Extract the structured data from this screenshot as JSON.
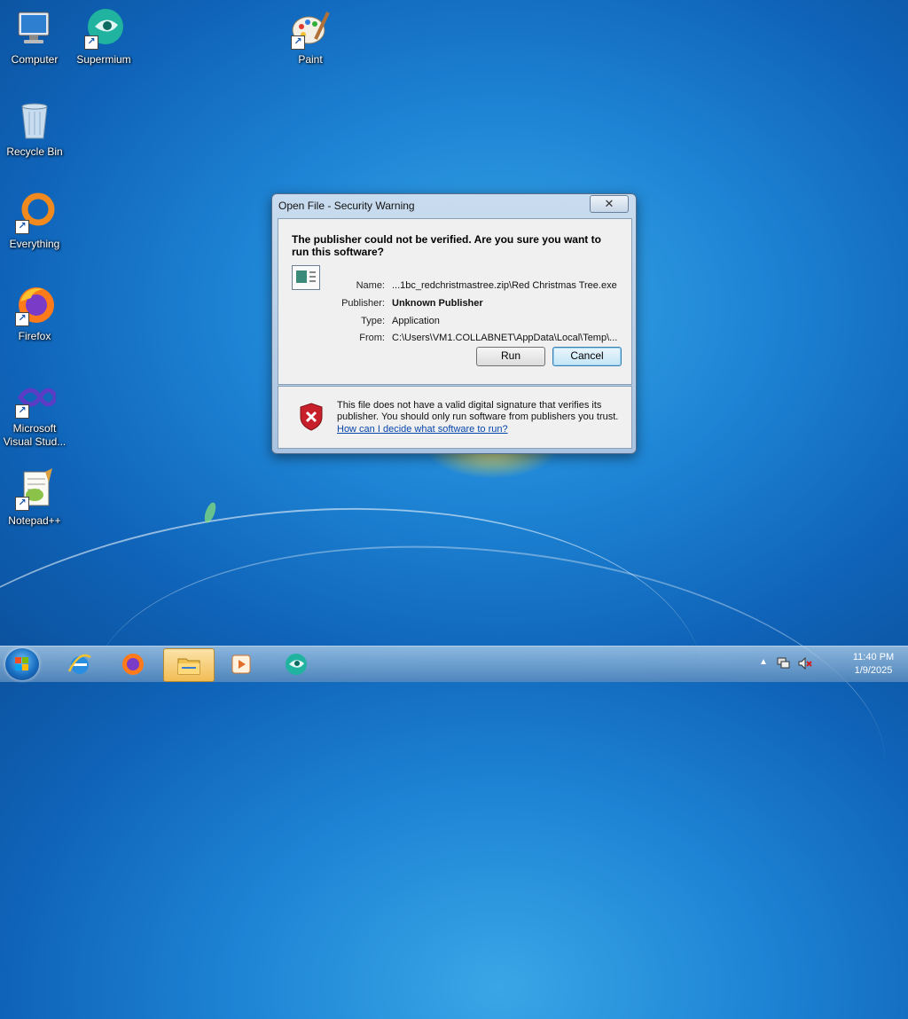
{
  "desktop": {
    "icons": [
      {
        "label": "Computer"
      },
      {
        "label": "Supermium"
      },
      {
        "label": "Paint"
      },
      {
        "label": "Recycle Bin"
      },
      {
        "label": "Everything"
      },
      {
        "label": "Firefox"
      },
      {
        "label": "Microsoft Visual Stud..."
      },
      {
        "label": "Notepad++"
      }
    ]
  },
  "dialog": {
    "title": "Open File - Security Warning",
    "close_glyph": "✕",
    "heading": "The publisher could not be verified.  Are you sure you want to run this software?",
    "fields": {
      "name_label": "Name:",
      "name_value": "...1bc_redchristmastree.zip\\Red Christmas Tree.exe",
      "publisher_label": "Publisher:",
      "publisher_value": "Unknown Publisher",
      "type_label": "Type:",
      "type_value": "Application",
      "from_label": "From:",
      "from_value": "C:\\Users\\VM1.COLLABNET\\AppData\\Local\\Temp\\..."
    },
    "run_label": "Run",
    "cancel_label": "Cancel",
    "warning_text": "This file does not have a valid digital signature that verifies its publisher.  You should only run software from publishers you trust.",
    "help_link": "How can I decide what software to run?"
  },
  "taskbar": {
    "items": [
      {
        "icon": "internet-explorer-icon"
      },
      {
        "icon": "firefox-icon"
      },
      {
        "icon": "file-explorer-icon",
        "active": true
      },
      {
        "icon": "media-player-icon"
      },
      {
        "icon": "supermium-icon"
      }
    ],
    "tray": {
      "time": "11:40 PM",
      "date": "1/9/2025",
      "arrow_glyph": "▲"
    }
  },
  "colors": {
    "accent": "#1f86d6",
    "link": "#0645ad",
    "shield_red": "#c8202a"
  }
}
